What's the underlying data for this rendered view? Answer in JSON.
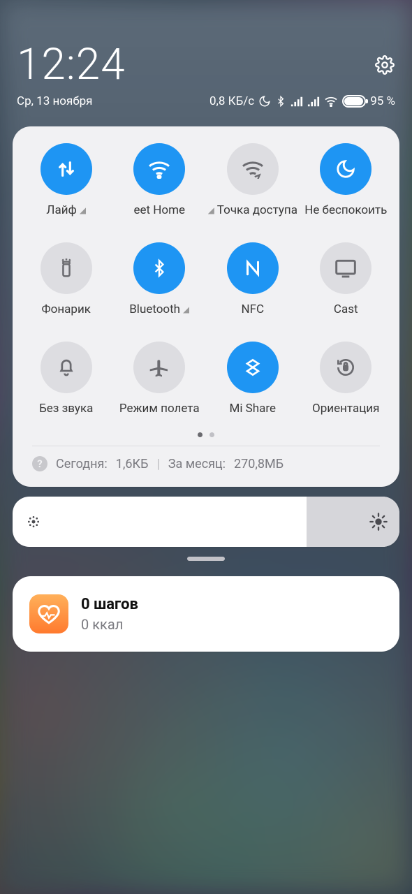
{
  "status": {
    "time": "12:24",
    "date": "Ср, 13 ноября",
    "data_speed": "0,8 КБ/с",
    "battery_percent": "95 %"
  },
  "qs": {
    "items": [
      {
        "label": "Лайф",
        "expandable": true
      },
      {
        "label": "eet Home",
        "expandable": false
      },
      {
        "label": "Точка доступа",
        "expandable": true
      },
      {
        "label": "Не беспокоить",
        "expandable": false
      },
      {
        "label": "Фонарик",
        "expandable": false
      },
      {
        "label": "Bluetooth",
        "expandable": true
      },
      {
        "label": "NFC",
        "expandable": false
      },
      {
        "label": "Cast",
        "expandable": false
      },
      {
        "label": "Без звука",
        "expandable": false
      },
      {
        "label": "Режим полета",
        "expandable": false
      },
      {
        "label": "Mi Share",
        "expandable": false
      },
      {
        "label": "Ориентация",
        "expandable": false
      }
    ]
  },
  "usage": {
    "today_label": "Сегодня:",
    "today_value": "1,6КБ",
    "month_label": "За месяц:",
    "month_value": "270,8МБ"
  },
  "notification": {
    "title": "0 шагов",
    "subtitle": "0 ккал"
  }
}
